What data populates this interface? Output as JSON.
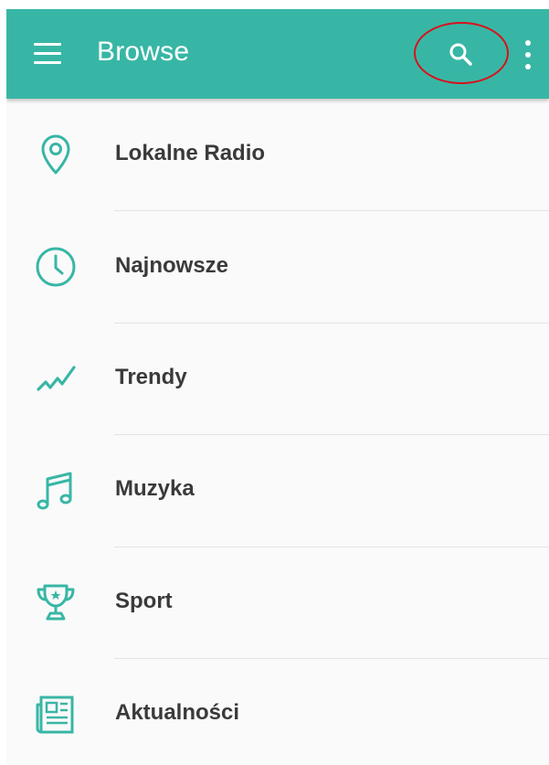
{
  "appbar": {
    "title": "Browse",
    "menu_icon": "hamburger-menu-icon",
    "search_icon": "search-icon",
    "overflow_icon": "more-vertical-icon",
    "background": "#38b6a5",
    "highlight_color": "#d8101c"
  },
  "list": {
    "accent": "#38b6a5",
    "items": [
      {
        "label": "Lokalne Radio",
        "icon": "location-pin-icon"
      },
      {
        "label": "Najnowsze",
        "icon": "clock-icon"
      },
      {
        "label": "Trendy",
        "icon": "trending-icon"
      },
      {
        "label": "Muzyka",
        "icon": "music-note-icon"
      },
      {
        "label": "Sport",
        "icon": "trophy-icon"
      },
      {
        "label": "Aktualności",
        "icon": "newspaper-icon"
      }
    ]
  }
}
